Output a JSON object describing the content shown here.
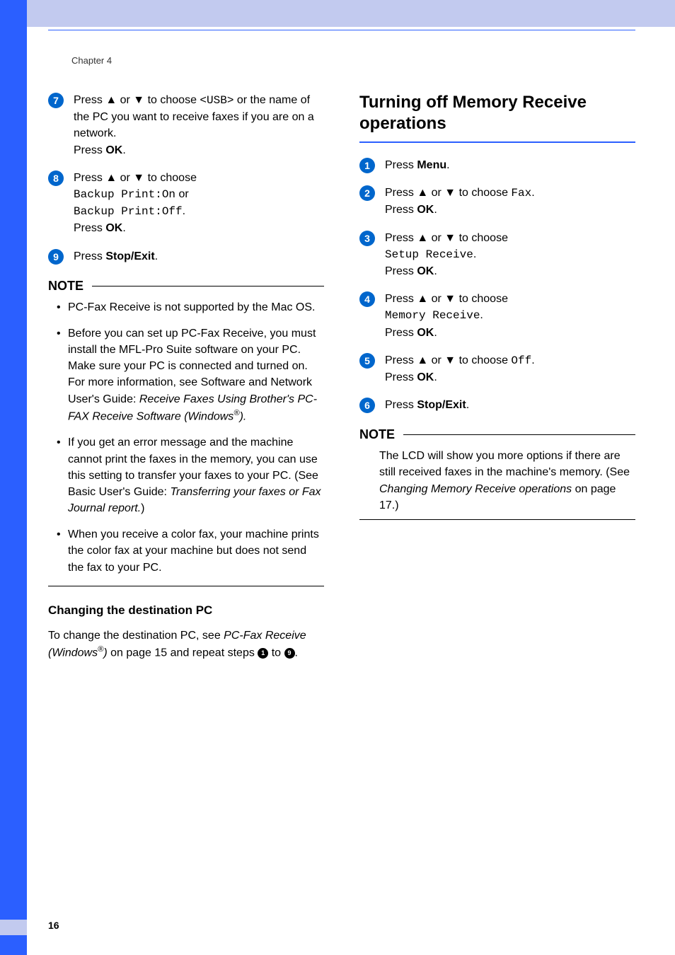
{
  "chapter": "Chapter 4",
  "page_number": "16",
  "left": {
    "step7": {
      "line1a": "Press ▲ or ▼ to choose ",
      "usb": "<USB>",
      "line1b": " or the name of the PC you want to receive faxes if you are on a network.",
      "press": "Press ",
      "ok": "OK",
      "dot": "."
    },
    "step8": {
      "line1": "Press ▲ or ▼ to choose ",
      "opt1": "Backup Print:On",
      "or": " or ",
      "opt2": "Backup Print:Off",
      "dot1": ".",
      "press": "Press ",
      "ok": "OK",
      "dot2": "."
    },
    "step9": {
      "press": "Press ",
      "stop": "Stop/Exit",
      "dot": "."
    },
    "note_label": "NOTE",
    "note1": "PC-Fax Receive is not supported by the Mac OS.",
    "note2a": "Before you can set up PC-Fax Receive, you must install the MFL-Pro Suite software on your PC. Make sure your PC is connected and turned on. For more information, see Software and Network User's Guide: ",
    "note2i": "Receive Faxes Using Brother's PC-FAX Receive Software (Windows",
    "note2reg": "®",
    "note2end": ").",
    "note3a": "If you get an error message and the machine cannot print the faxes in the memory, you can use this setting to transfer your faxes to your PC. (See Basic User's Guide: ",
    "note3i": "Transferring your faxes or Fax Journal report.",
    "note3end": ")",
    "note4": "When you receive a color fax, your machine prints the color fax at your machine but does not send the fax to your PC.",
    "subhead": "Changing the destination PC",
    "para_a": "To change the destination PC, see ",
    "para_i": "PC-Fax Receive (Windows",
    "para_reg": "®",
    "para_i2": ")",
    "para_b": " on page 15 and repeat steps ",
    "para_to": " to ",
    "para_end": "."
  },
  "right": {
    "h1": "Turning off Memory Receive operations",
    "s1": {
      "press": "Press ",
      "menu": "Menu",
      "dot": "."
    },
    "s2": {
      "l1": "Press ▲ or ▼ to choose ",
      "fax": "Fax",
      "dot1": ".",
      "press": "Press ",
      "ok": "OK",
      "dot2": "."
    },
    "s3": {
      "l1": "Press ▲ or ▼ to choose ",
      "sr": "Setup Receive",
      "dot1": ".",
      "press": "Press ",
      "ok": "OK",
      "dot2": "."
    },
    "s4": {
      "l1": "Press ▲ or ▼ to choose ",
      "mr": "Memory Receive",
      "dot1": ".",
      "press": "Press ",
      "ok": "OK",
      "dot2": "."
    },
    "s5": {
      "l1": "Press ▲ or ▼ to choose ",
      "off": "Off",
      "dot1": ".",
      "press": "Press ",
      "ok": "OK",
      "dot2": "."
    },
    "s6": {
      "press": "Press ",
      "stop": "Stop/Exit",
      "dot": "."
    },
    "note_label": "NOTE",
    "note_a": "The LCD will show you more options if there are still received faxes in the machine's memory. (See ",
    "note_i": "Changing Memory Receive operations",
    "note_b": " on page 17.)"
  }
}
